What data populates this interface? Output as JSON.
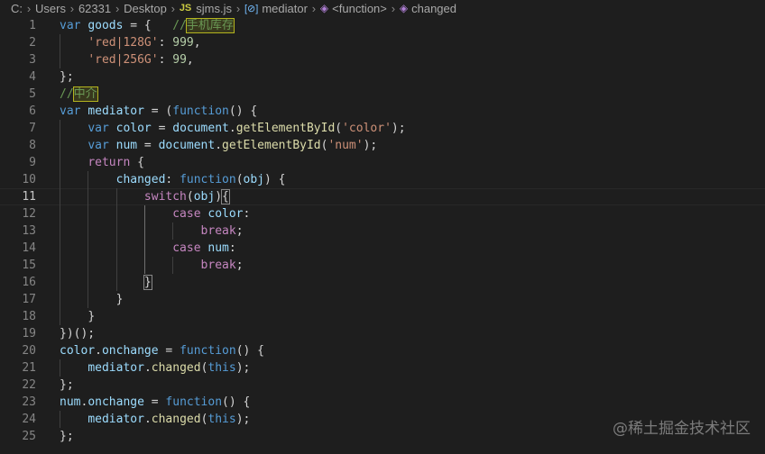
{
  "breadcrumb": {
    "segments": [
      "C:",
      "Users",
      "62331",
      "Desktop"
    ],
    "file_badge": "JS",
    "file_name": "sjms.js",
    "symbols": [
      "mediator",
      "<function>",
      "changed"
    ]
  },
  "editor": {
    "current_line": 11,
    "line_numbers": [
      "1",
      "2",
      "3",
      "4",
      "5",
      "6",
      "7",
      "8",
      "9",
      "10",
      "11",
      "12",
      "13",
      "14",
      "15",
      "16",
      "17",
      "18",
      "19",
      "20",
      "21",
      "22",
      "23",
      "24",
      "25"
    ],
    "lines": [
      {
        "indent": "",
        "tokens": [
          {
            "t": "var",
            "c": "kw"
          },
          {
            "t": " "
          },
          {
            "t": "goods",
            "c": "var"
          },
          {
            "t": " = {   "
          },
          {
            "t": "//",
            "c": "cmt"
          },
          {
            "t": "手机库存",
            "c": "cmt cjk hl-box"
          }
        ]
      },
      {
        "indent": "    ",
        "tokens": [
          {
            "t": "'red|128G'",
            "c": "str"
          },
          {
            "t": ": "
          },
          {
            "t": "999",
            "c": "num"
          },
          {
            "t": ","
          }
        ]
      },
      {
        "indent": "    ",
        "tokens": [
          {
            "t": "'red|256G'",
            "c": "str"
          },
          {
            "t": ": "
          },
          {
            "t": "99",
            "c": "num"
          },
          {
            "t": ","
          }
        ]
      },
      {
        "indent": "",
        "tokens": [
          {
            "t": "};"
          }
        ]
      },
      {
        "indent": "",
        "tokens": [
          {
            "t": "//",
            "c": "cmt"
          },
          {
            "t": "中介",
            "c": "cmt cjk hl-box"
          }
        ]
      },
      {
        "indent": "",
        "tokens": [
          {
            "t": "var",
            "c": "kw"
          },
          {
            "t": " "
          },
          {
            "t": "mediator",
            "c": "var"
          },
          {
            "t": " = ("
          },
          {
            "t": "function",
            "c": "kw"
          },
          {
            "t": "() {"
          }
        ]
      },
      {
        "indent": "    ",
        "tokens": [
          {
            "t": "var",
            "c": "kw"
          },
          {
            "t": " "
          },
          {
            "t": "color",
            "c": "var"
          },
          {
            "t": " = "
          },
          {
            "t": "document",
            "c": "var"
          },
          {
            "t": "."
          },
          {
            "t": "getElementById",
            "c": "fn"
          },
          {
            "t": "("
          },
          {
            "t": "'color'",
            "c": "str"
          },
          {
            "t": ");"
          }
        ]
      },
      {
        "indent": "    ",
        "tokens": [
          {
            "t": "var",
            "c": "kw"
          },
          {
            "t": " "
          },
          {
            "t": "num",
            "c": "var"
          },
          {
            "t": " = "
          },
          {
            "t": "document",
            "c": "var"
          },
          {
            "t": "."
          },
          {
            "t": "getElementById",
            "c": "fn"
          },
          {
            "t": "("
          },
          {
            "t": "'num'",
            "c": "str"
          },
          {
            "t": ");"
          }
        ]
      },
      {
        "indent": "    ",
        "tokens": [
          {
            "t": "return",
            "c": "ctl"
          },
          {
            "t": " {"
          }
        ]
      },
      {
        "indent": "        ",
        "tokens": [
          {
            "t": "changed",
            "c": "var"
          },
          {
            "t": ": "
          },
          {
            "t": "function",
            "c": "kw"
          },
          {
            "t": "("
          },
          {
            "t": "obj",
            "c": "var"
          },
          {
            "t": ") {"
          }
        ]
      },
      {
        "indent": "            ",
        "tokens": [
          {
            "t": "switch",
            "c": "ctl"
          },
          {
            "t": "("
          },
          {
            "t": "obj",
            "c": "var"
          },
          {
            "t": ")"
          },
          {
            "t": "{",
            "c": "bm"
          }
        ]
      },
      {
        "indent": "                ",
        "tokens": [
          {
            "t": "case",
            "c": "ctl"
          },
          {
            "t": " "
          },
          {
            "t": "color",
            "c": "var"
          },
          {
            "t": ":"
          }
        ]
      },
      {
        "indent": "                    ",
        "tokens": [
          {
            "t": "break",
            "c": "ctl"
          },
          {
            "t": ";"
          }
        ]
      },
      {
        "indent": "                ",
        "tokens": [
          {
            "t": "case",
            "c": "ctl"
          },
          {
            "t": " "
          },
          {
            "t": "num",
            "c": "var"
          },
          {
            "t": ":"
          }
        ]
      },
      {
        "indent": "                    ",
        "tokens": [
          {
            "t": "break",
            "c": "ctl"
          },
          {
            "t": ";"
          }
        ]
      },
      {
        "indent": "            ",
        "tokens": [
          {
            "t": "}",
            "c": "bm"
          }
        ]
      },
      {
        "indent": "        ",
        "tokens": [
          {
            "t": "}"
          }
        ]
      },
      {
        "indent": "    ",
        "tokens": [
          {
            "t": "}"
          }
        ]
      },
      {
        "indent": "",
        "tokens": [
          {
            "t": "})();"
          }
        ]
      },
      {
        "indent": "",
        "tokens": [
          {
            "t": "color",
            "c": "var"
          },
          {
            "t": "."
          },
          {
            "t": "onchange",
            "c": "var"
          },
          {
            "t": " = "
          },
          {
            "t": "function",
            "c": "kw"
          },
          {
            "t": "() {"
          }
        ]
      },
      {
        "indent": "    ",
        "tokens": [
          {
            "t": "mediator",
            "c": "var"
          },
          {
            "t": "."
          },
          {
            "t": "changed",
            "c": "fn"
          },
          {
            "t": "("
          },
          {
            "t": "this",
            "c": "kw"
          },
          {
            "t": ");"
          }
        ]
      },
      {
        "indent": "",
        "tokens": [
          {
            "t": "};"
          }
        ]
      },
      {
        "indent": "",
        "tokens": [
          {
            "t": "num",
            "c": "var"
          },
          {
            "t": "."
          },
          {
            "t": "onchange",
            "c": "var"
          },
          {
            "t": " = "
          },
          {
            "t": "function",
            "c": "kw"
          },
          {
            "t": "() {"
          }
        ]
      },
      {
        "indent": "    ",
        "tokens": [
          {
            "t": "mediator",
            "c": "var"
          },
          {
            "t": "."
          },
          {
            "t": "changed",
            "c": "fn"
          },
          {
            "t": "("
          },
          {
            "t": "this",
            "c": "kw"
          },
          {
            "t": ");"
          }
        ]
      },
      {
        "indent": "",
        "tokens": [
          {
            "t": "};"
          }
        ]
      }
    ]
  },
  "watermark": "@稀土掘金技术社区",
  "colors": {
    "background": "#1e1e1e",
    "keyword": "#569cd6",
    "control": "#c586c0",
    "variable": "#9cdcfe",
    "function": "#dcdcaa",
    "string": "#ce9178",
    "number": "#b5cea8",
    "comment": "#6a9955"
  }
}
